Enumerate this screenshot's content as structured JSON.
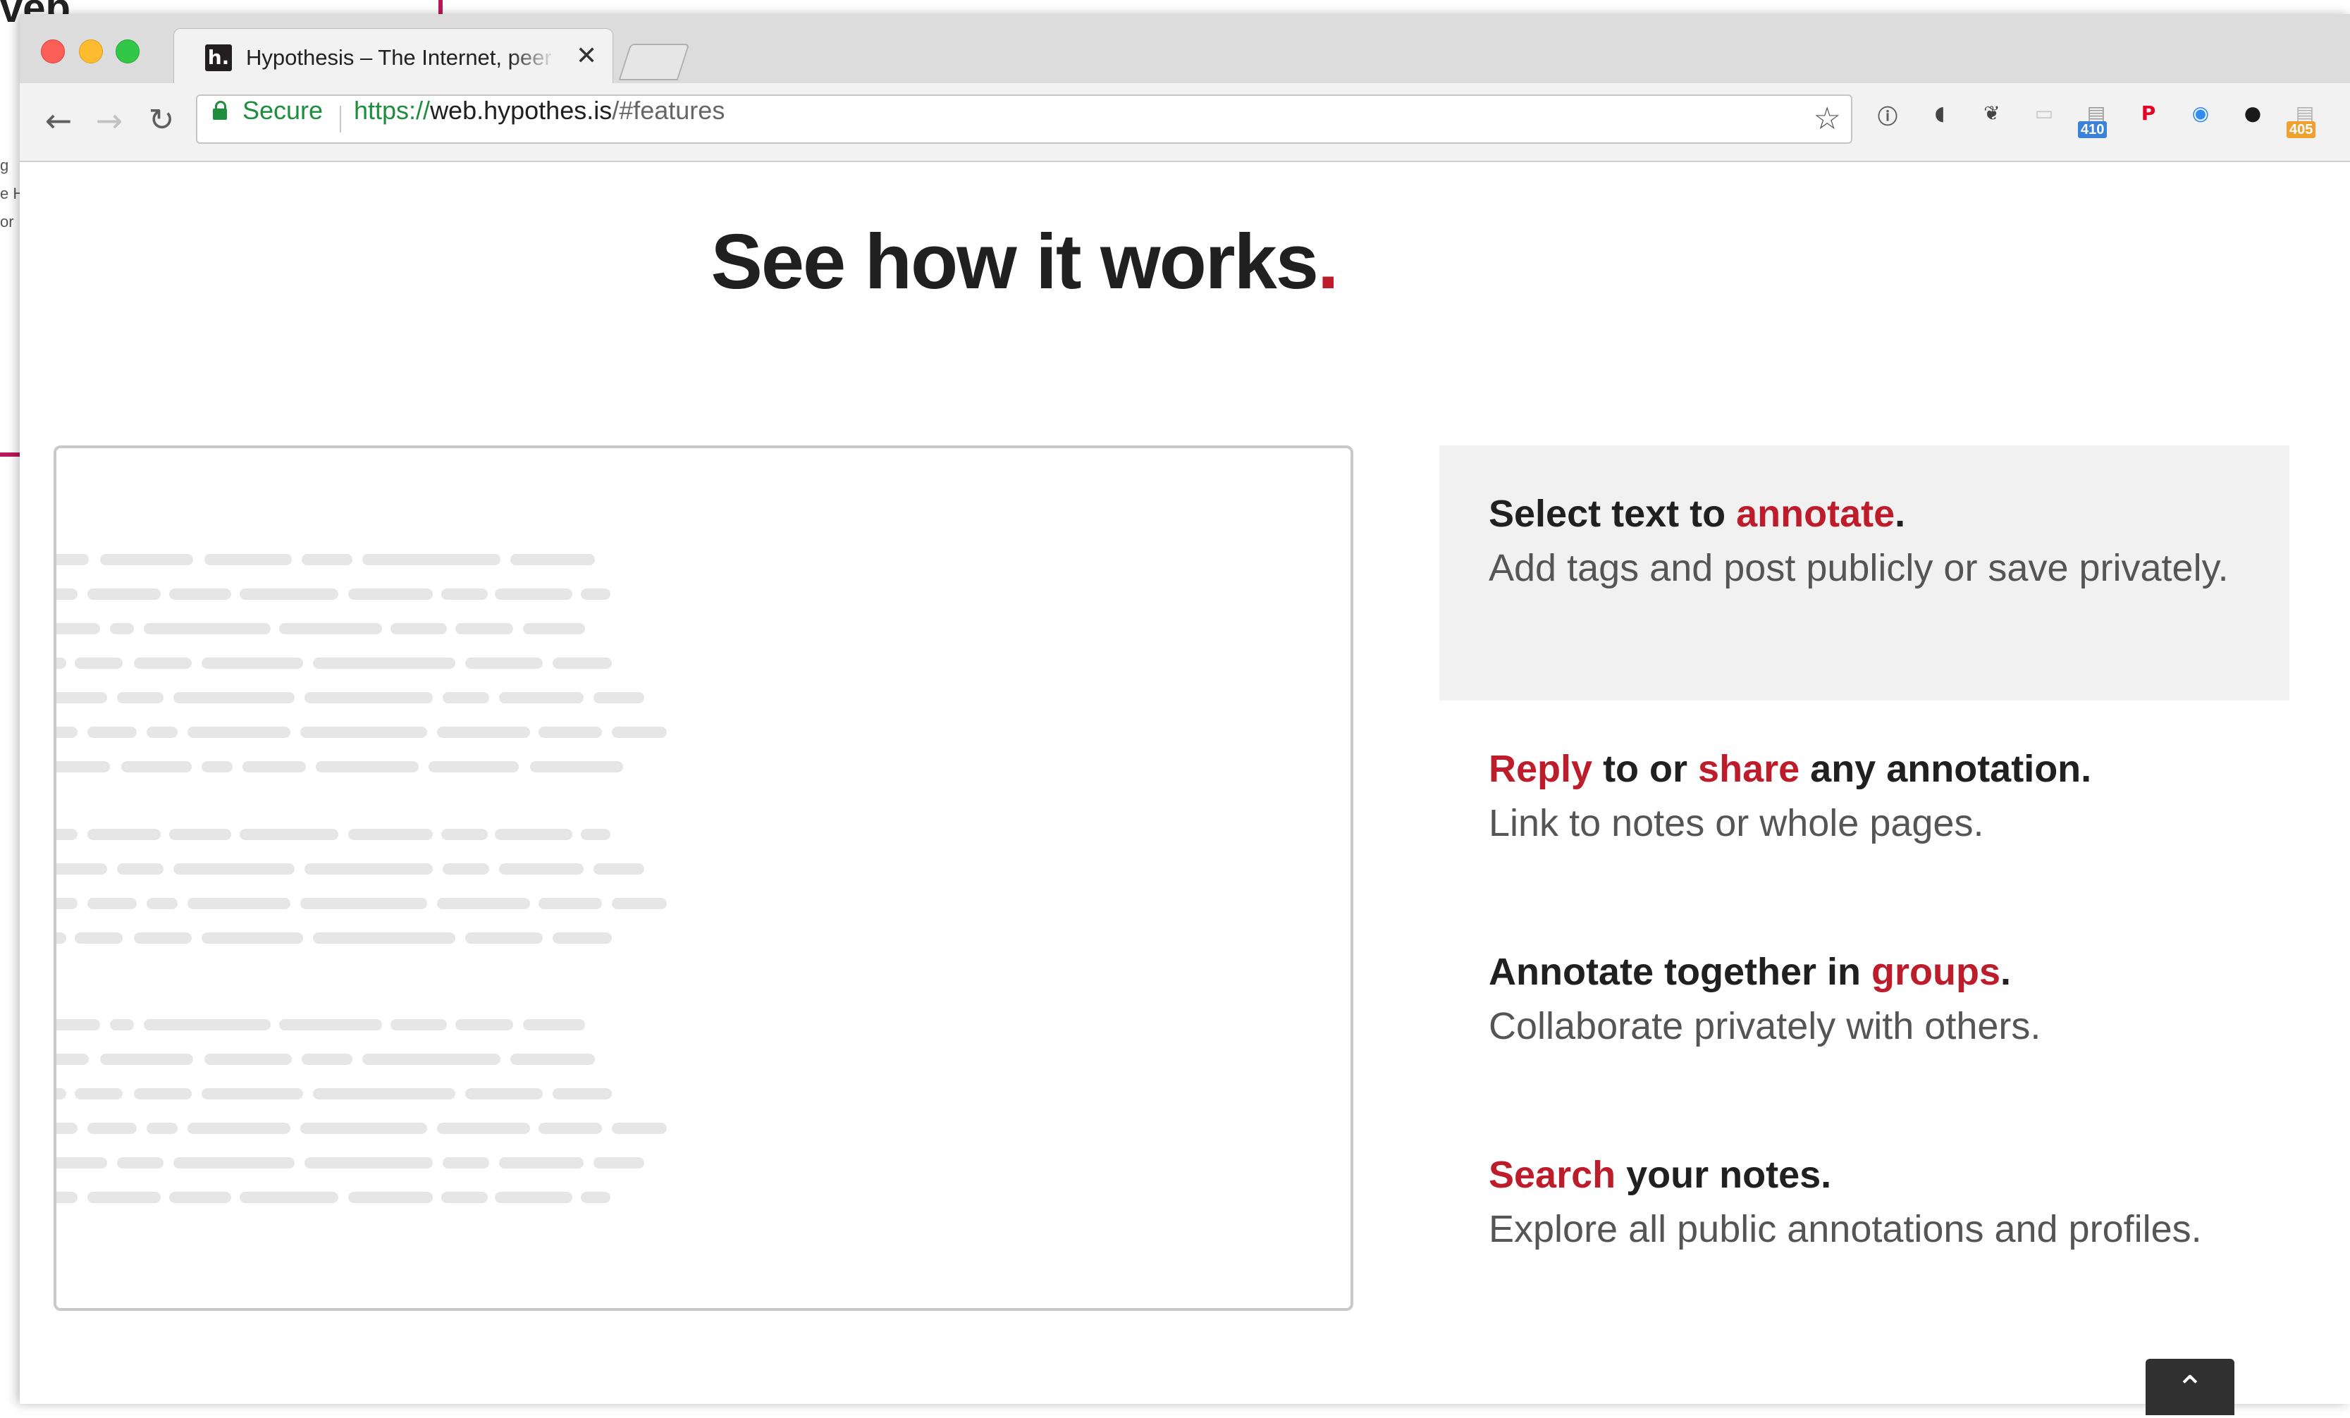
{
  "background": {
    "title_fragment": "veb",
    "snippets": [
      "g",
      "e H",
      "or"
    ]
  },
  "browser": {
    "tab": {
      "title": "Hypothesis – The Internet, peer reviewed",
      "favicon_text": "h.",
      "close_glyph": "✕"
    },
    "address": {
      "secure_label": "Secure",
      "url_scheme": "https://",
      "url_host": "web.hypothes.is",
      "url_path": "/#features"
    },
    "extensions": [
      {
        "icon": "info-icon",
        "glyph": "ⓘ",
        "color": "#5f5f5f"
      },
      {
        "icon": "pocket-icon",
        "glyph": "◖",
        "color": "#444444"
      },
      {
        "icon": "evernote-icon",
        "glyph": "❦",
        "color": "#444444"
      },
      {
        "icon": "chat-icon",
        "glyph": "▭",
        "color": "#c8c8c8"
      },
      {
        "icon": "inbox-icon",
        "glyph": "▤",
        "color": "#9a9a9a",
        "badge": "410",
        "badge_color": "#3b82d8"
      },
      {
        "icon": "pinterest-icon",
        "glyph": "P",
        "color": "#e60023"
      },
      {
        "icon": "messenger-icon",
        "glyph": "◉",
        "color": "#2e8cf5"
      },
      {
        "icon": "color-wheel-icon",
        "glyph": "●",
        "color": "#1a1a1a"
      },
      {
        "icon": "tab-counter-icon",
        "glyph": "▤",
        "color": "#b0b0b0",
        "badge": "405",
        "badge_color": "#f0a030"
      }
    ]
  },
  "main": {
    "heading": "See how it works",
    "heading_dot": ".",
    "features": [
      {
        "pre": "Select text to ",
        "hl": "annotate",
        "post": ".",
        "desc": "Add tags and post publicly or save privately."
      },
      {
        "hl": "Reply",
        "mid": " to or ",
        "hl2": "share",
        "post": " any annotation.",
        "desc": "Link to notes or whole pages."
      },
      {
        "pre": "Annotate together in ",
        "hl": "groups",
        "post": ".",
        "desc": "Collaborate privately with others."
      },
      {
        "hl": "Search",
        "post": " your notes.",
        "desc": "Explore all public annotations and profiles."
      }
    ],
    "back_to_top_glyph": "⌃"
  },
  "colors": {
    "accent_red": "#bd1c2b",
    "secure_green": "#1e8e3e",
    "heading_text": "#202020"
  }
}
